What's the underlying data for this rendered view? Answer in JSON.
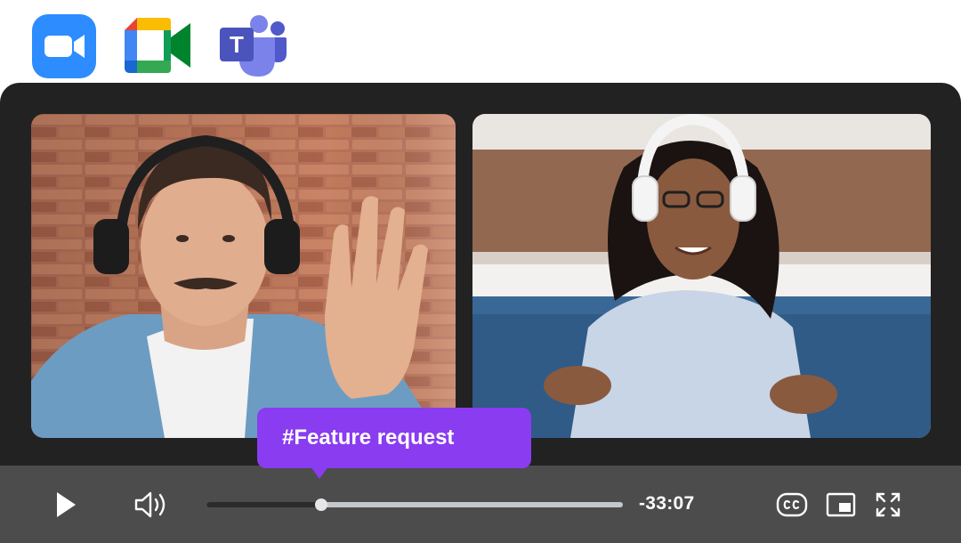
{
  "apps": [
    {
      "name": "zoom",
      "icon": "zoom-logo-icon",
      "color": "#2d8cff"
    },
    {
      "name": "google-meet",
      "icon": "google-meet-logo-icon"
    },
    {
      "name": "microsoft-teams",
      "icon": "teams-logo-icon",
      "color": "#5059c9",
      "letter": "T"
    }
  ],
  "player": {
    "participants": [
      {
        "icon": "participant-video-man"
      },
      {
        "icon": "participant-video-woman"
      }
    ],
    "tag_tooltip": "#Feature request",
    "controls": {
      "play_icon": "play-icon",
      "volume_icon": "volume-icon",
      "progress": 0.275,
      "time_remaining": "-33:07",
      "captions_icon": "closed-captions-icon",
      "pip_icon": "picture-in-picture-icon",
      "fullscreen_icon": "fullscreen-icon"
    },
    "colors": {
      "background": "#222222",
      "control_bar": "#4c4c4c",
      "accent": "#8a3cf0"
    }
  }
}
